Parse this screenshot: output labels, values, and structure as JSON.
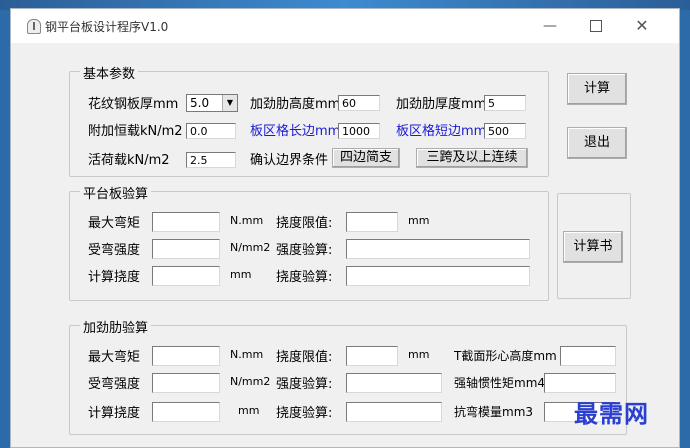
{
  "window": {
    "title": "钢平台板设计程序V1.0",
    "minimize_glyph": "—",
    "close_glyph": "✕"
  },
  "basic": {
    "legend": "基本参数",
    "plate_thickness_label": "花纹钢板厚mm",
    "plate_thickness_value": "5.0",
    "rib_height_label": "加劲肋高度mm",
    "rib_height_value": "60",
    "rib_thickness_label": "加劲肋厚度mm",
    "rib_thickness_value": "5",
    "dead_load_label": "附加恒载kN/m2",
    "dead_load_value": "0.0",
    "long_side_label": "板区格长边mm",
    "long_side_value": "1000",
    "short_side_label": "板区格短边mm",
    "short_side_value": "500",
    "live_load_label": "活荷载kN/m2",
    "live_load_value": "2.5",
    "boundary_label": "确认边界条件",
    "boundary_btn1": "四边简支",
    "boundary_btn2": "三跨及以上连续"
  },
  "plate_check": {
    "legend": "平台板验算",
    "max_moment_label": "最大弯矩",
    "moment_unit": "N.mm",
    "deflection_limit_label": "挠度限值:",
    "deflection_limit_unit": "mm",
    "bending_strength_label": "受弯强度",
    "strength_unit": "N/mm2",
    "strength_check_label": "强度验算:",
    "calc_deflection_label": "计算挠度",
    "calc_deflection_unit": "mm",
    "deflection_check_label": "挠度验算:"
  },
  "rib_check": {
    "legend": "加劲肋验算",
    "max_moment_label": "最大弯矩",
    "moment_unit": "N.mm",
    "deflection_limit_label": "挠度限值:",
    "deflection_limit_unit": "mm",
    "t_centroid_label": "T截面形心高度mm",
    "bending_strength_label": "受弯强度",
    "strength_unit": "N/mm2",
    "strength_check_label": "强度验算:",
    "inertia_label": "强轴惯性矩mm4",
    "calc_deflection_label": "计算挠度",
    "calc_deflection_unit": "mm",
    "deflection_check_label": "挠度验算:",
    "section_modulus_label": "抗弯模量mm3"
  },
  "buttons": {
    "calculate": "计算",
    "exit": "退出",
    "report": "计算书"
  },
  "watermark": "最需网",
  "icons": {
    "app": "app-icon",
    "dropdown": "chevron-down-icon",
    "maximize": "maximize-icon"
  }
}
